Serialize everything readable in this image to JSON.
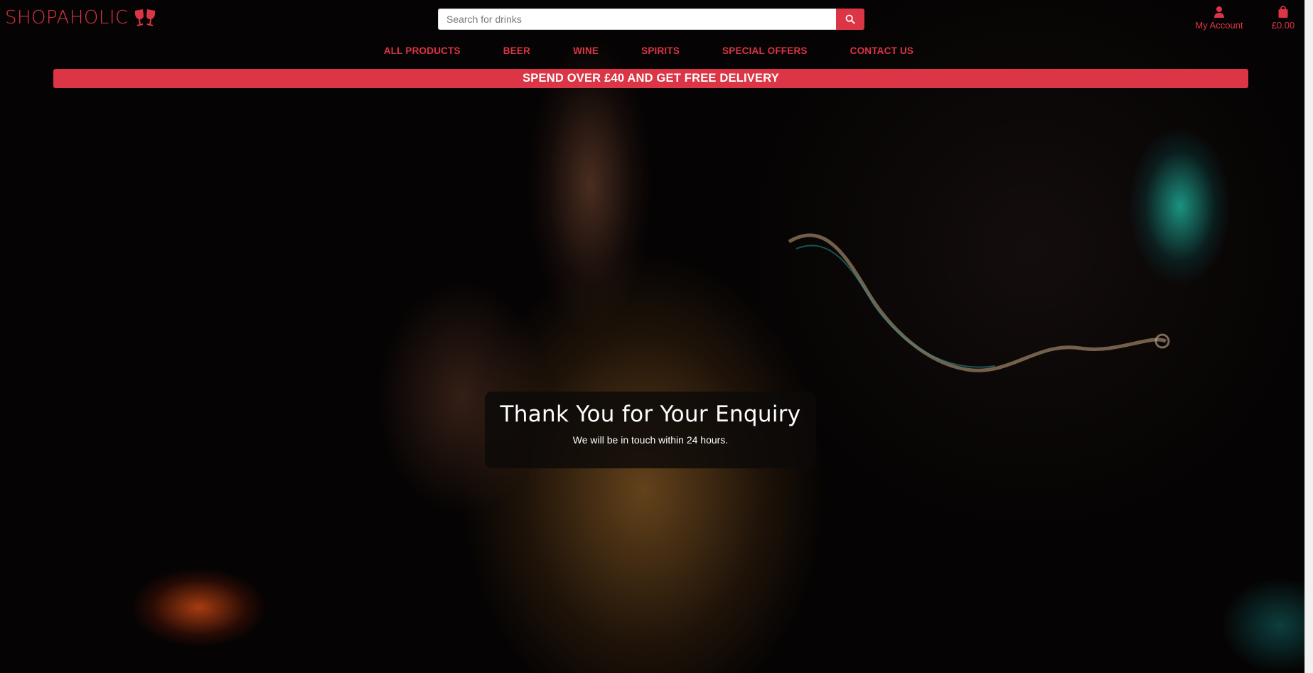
{
  "brand": {
    "name": "SHOPAHOLIC",
    "accent_color": "#dc3545",
    "logo_icon": "glasses-cheers-icon"
  },
  "search": {
    "placeholder": "Search for drinks",
    "icon": "search-icon"
  },
  "account": {
    "label": "My Account",
    "icon": "user-icon"
  },
  "cart": {
    "total": "£0.00",
    "icon": "shopping-bag-icon"
  },
  "nav": {
    "items": [
      {
        "label": "ALL PRODUCTS"
      },
      {
        "label": "BEER"
      },
      {
        "label": "WINE"
      },
      {
        "label": "SPIRITS"
      },
      {
        "label": "SPECIAL OFFERS"
      },
      {
        "label": "CONTACT US"
      }
    ]
  },
  "banner": {
    "text": "SPEND OVER £40 AND GET FREE DELIVERY"
  },
  "message": {
    "title": "Thank You for Your Enquiry",
    "body": "We will be in touch within 24 hours."
  }
}
